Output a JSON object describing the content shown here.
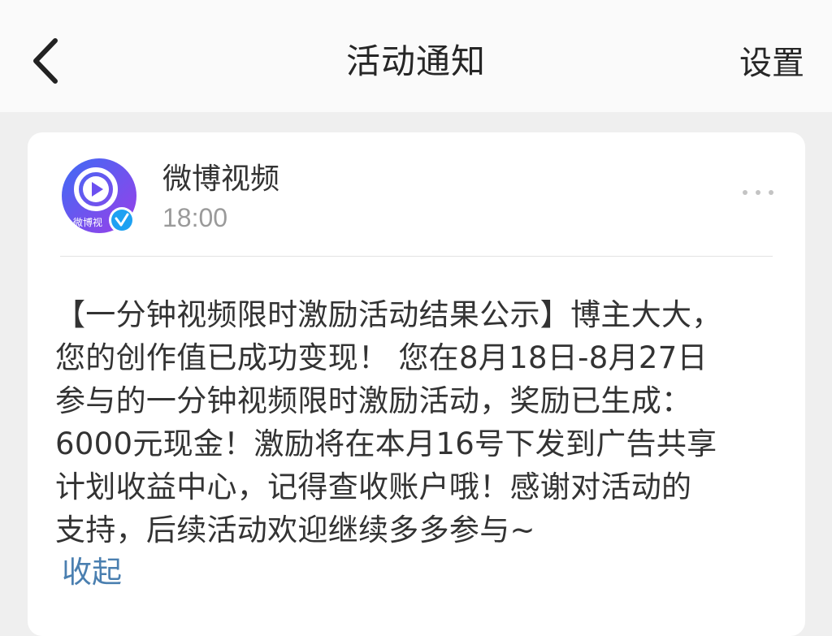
{
  "header": {
    "title": "活动通知",
    "settings_label": "设置"
  },
  "notification": {
    "sender": "微博视频",
    "avatar_text": "微博视",
    "time": "18:00",
    "body": "【一分钟视频限时激励活动结果公示】博主大大，\n您的创作值已成功变现！ 您在8月18日-8月27日\n参与的一分钟视频限时激励活动，奖励已生成：\n6000元现金！激励将在本月16号下发到广告共享\n计划收益中心，记得查收账户哦！感谢对活动的\n支持，后续活动欢迎继续多多参与~",
    "collapse_label": "收起"
  },
  "colors": {
    "link": "#4a7fb0",
    "verified_badge": "#1da1f2",
    "avatar_gradient_start": "#3e6cf5",
    "avatar_gradient_end": "#9b3ee8"
  },
  "icons": {
    "back": "chevron-left-icon",
    "more": "more-dots-icon",
    "verified": "verified-badge-icon",
    "play": "play-icon"
  }
}
